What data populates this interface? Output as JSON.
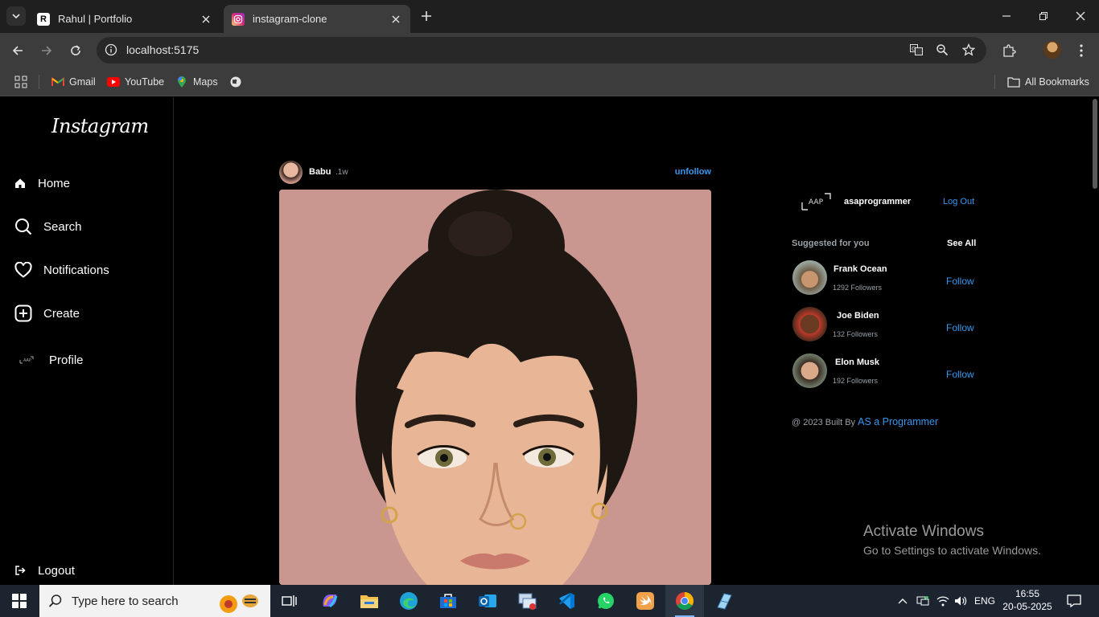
{
  "browser": {
    "tabs": [
      {
        "title": "Rahul | Portfolio",
        "favicon": "R"
      },
      {
        "title": "instagram-clone",
        "favicon": "instagram-favicon"
      }
    ],
    "url": "localhost:5175",
    "bookmarks": [
      {
        "label": "Gmail"
      },
      {
        "label": "YouTube"
      },
      {
        "label": "Maps"
      }
    ],
    "all_bookmarks_label": "All Bookmarks"
  },
  "sidebar": {
    "logo": "Instagram",
    "items": [
      {
        "label": "Home",
        "icon": "home-icon"
      },
      {
        "label": "Search",
        "icon": "search-icon"
      },
      {
        "label": "Notifications",
        "icon": "heart-icon"
      },
      {
        "label": "Create",
        "icon": "plus-square-icon"
      },
      {
        "label": "Profile",
        "icon": "profile-logo-icon"
      }
    ],
    "logout_label": "Logout"
  },
  "post": {
    "username": "Babu",
    "time": ".1w",
    "unfollow_label": "unfollow"
  },
  "suggestions_panel": {
    "current_user": "asaprogrammer",
    "logout_label": "Log Out",
    "suggested_title": "Suggested for you",
    "see_all_label": "See All",
    "users": [
      {
        "name": "Frank Ocean",
        "followers": "1292 Followers",
        "follow_label": "Follow"
      },
      {
        "name": "Joe Biden",
        "followers": "132 Followers",
        "follow_label": "Follow"
      },
      {
        "name": "Elon Musk",
        "followers": "192 Followers",
        "follow_label": "Follow"
      }
    ],
    "footer_text": "@ 2023 Built By",
    "footer_link": "AS a Programmer"
  },
  "watermark": {
    "line1": "Activate Windows",
    "line2": "Go to Settings to activate Windows."
  },
  "taskbar": {
    "search_placeholder": "Type here to search",
    "language": "ENG",
    "time": "16:55",
    "date": "20-05-2025"
  },
  "colors": {
    "accent_blue": "#3897f0",
    "background": "#000000",
    "chrome_dark": "#3c3c3c"
  }
}
